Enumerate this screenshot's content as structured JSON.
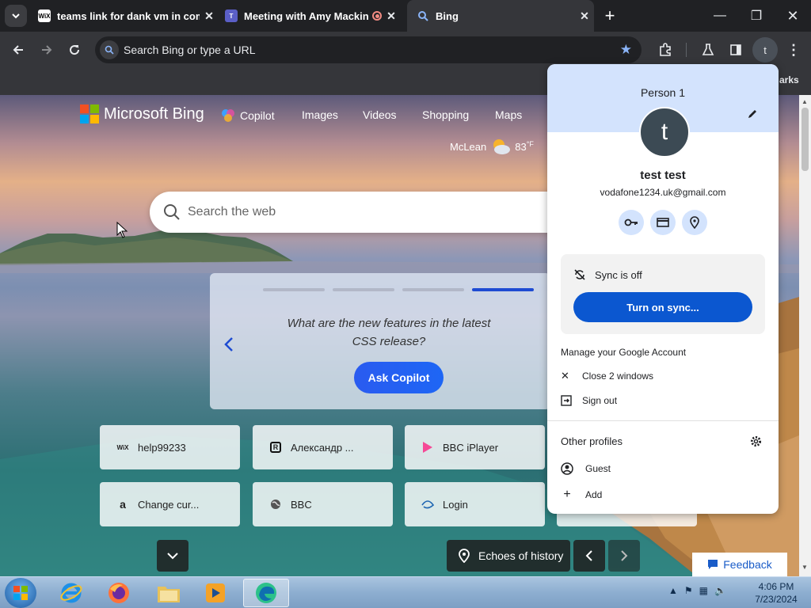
{
  "browser": {
    "tabs": [
      {
        "title": "teams link for dank vm in com",
        "favicon": "wix-favicon"
      },
      {
        "title": "Meeting with Amy Macking",
        "favicon": "teams-favicon"
      },
      {
        "title": "Bing",
        "favicon": "bing-search-favicon"
      }
    ],
    "omnibox_placeholder": "Search Bing or type a URL",
    "profile_letter": "t",
    "bookmarks_label": "arks"
  },
  "bing": {
    "logo_text": "Microsoft Bing",
    "nav": [
      "Copilot",
      "Images",
      "Videos",
      "Shopping",
      "Maps"
    ],
    "weather_location": "McLean",
    "weather_temp": "83",
    "weather_unit": "°F",
    "search_placeholder": "Search the web",
    "copilot_card": {
      "question": "What are the new features in the latest CSS release?",
      "button": "Ask Copilot",
      "active_dot": 4,
      "total_dots": 4
    },
    "quicklinks": [
      {
        "label": "help99233",
        "icon": "wix-icon"
      },
      {
        "label": "Александр ...",
        "icon": "r-app-icon"
      },
      {
        "label": "BBC iPlayer",
        "icon": "bbc-iplayer-icon"
      },
      {
        "label": "Change cur...",
        "icon": "amazon-icon"
      },
      {
        "label": "BBC",
        "icon": "globe-icon"
      },
      {
        "label": "Login",
        "icon": "disney-icon"
      }
    ],
    "image_caption": "Echoes of history",
    "feedback": "Feedback"
  },
  "profile_menu": {
    "header": "Person 1",
    "avatar_letter": "t",
    "name": "test test",
    "email": "vodafone1234.uk@gmail.com",
    "sync_status": "Sync is off",
    "sync_button": "Turn on sync...",
    "manage_account": "Manage your Google Account",
    "close_windows": "Close 2 windows",
    "sign_out": "Sign out",
    "other_profiles": "Other profiles",
    "guest": "Guest",
    "add": "Add"
  },
  "taskbar": {
    "time": "4:06 PM",
    "date": "7/23/2024"
  }
}
